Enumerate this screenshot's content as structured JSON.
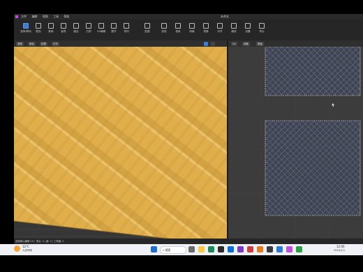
{
  "menubar": {
    "items": [
      "文件",
      "编辑",
      "视图",
      "工具",
      "帮助"
    ],
    "right_label": "未命名"
  },
  "toolbar": {
    "buttons": [
      {
        "label": "选择/移动",
        "active": true
      },
      {
        "label": "框选"
      },
      {
        "label": "套索"
      },
      {
        "label": "画笔"
      },
      {
        "label": "缝合"
      },
      {
        "label": "分割"
      },
      {
        "label": "UV编辑"
      },
      {
        "label": "展开"
      },
      {
        "label": "排列"
      },
      {
        "label": "贴图"
      },
      {
        "label": "烘焙"
      },
      {
        "label": "渲染"
      },
      {
        "label": "网格"
      },
      {
        "label": "镜像"
      },
      {
        "label": "对齐"
      },
      {
        "label": "缩放"
      },
      {
        "label": "设置"
      },
      {
        "label": "导出"
      }
    ]
  },
  "viewport3d": {
    "chips": [
      "透视",
      "着色",
      "纹理",
      "灯光"
    ]
  },
  "uv_editor": {
    "chips": [
      "UV",
      "网格",
      "棋盘"
    ],
    "pattern_color": "#8a93a8"
  },
  "fabric": {
    "color": "#e5b451",
    "shade": "#c99b3f"
  },
  "statusbar": {
    "text": "选择面以编辑 UV | 顶点: 0 | 面: 0 | 三角面: 0"
  },
  "taskbar": {
    "weather": "12°C",
    "weather_sub": "大部晴朗",
    "search_placeholder": "搜索",
    "time": "12:00",
    "date": "2024/1/1"
  }
}
